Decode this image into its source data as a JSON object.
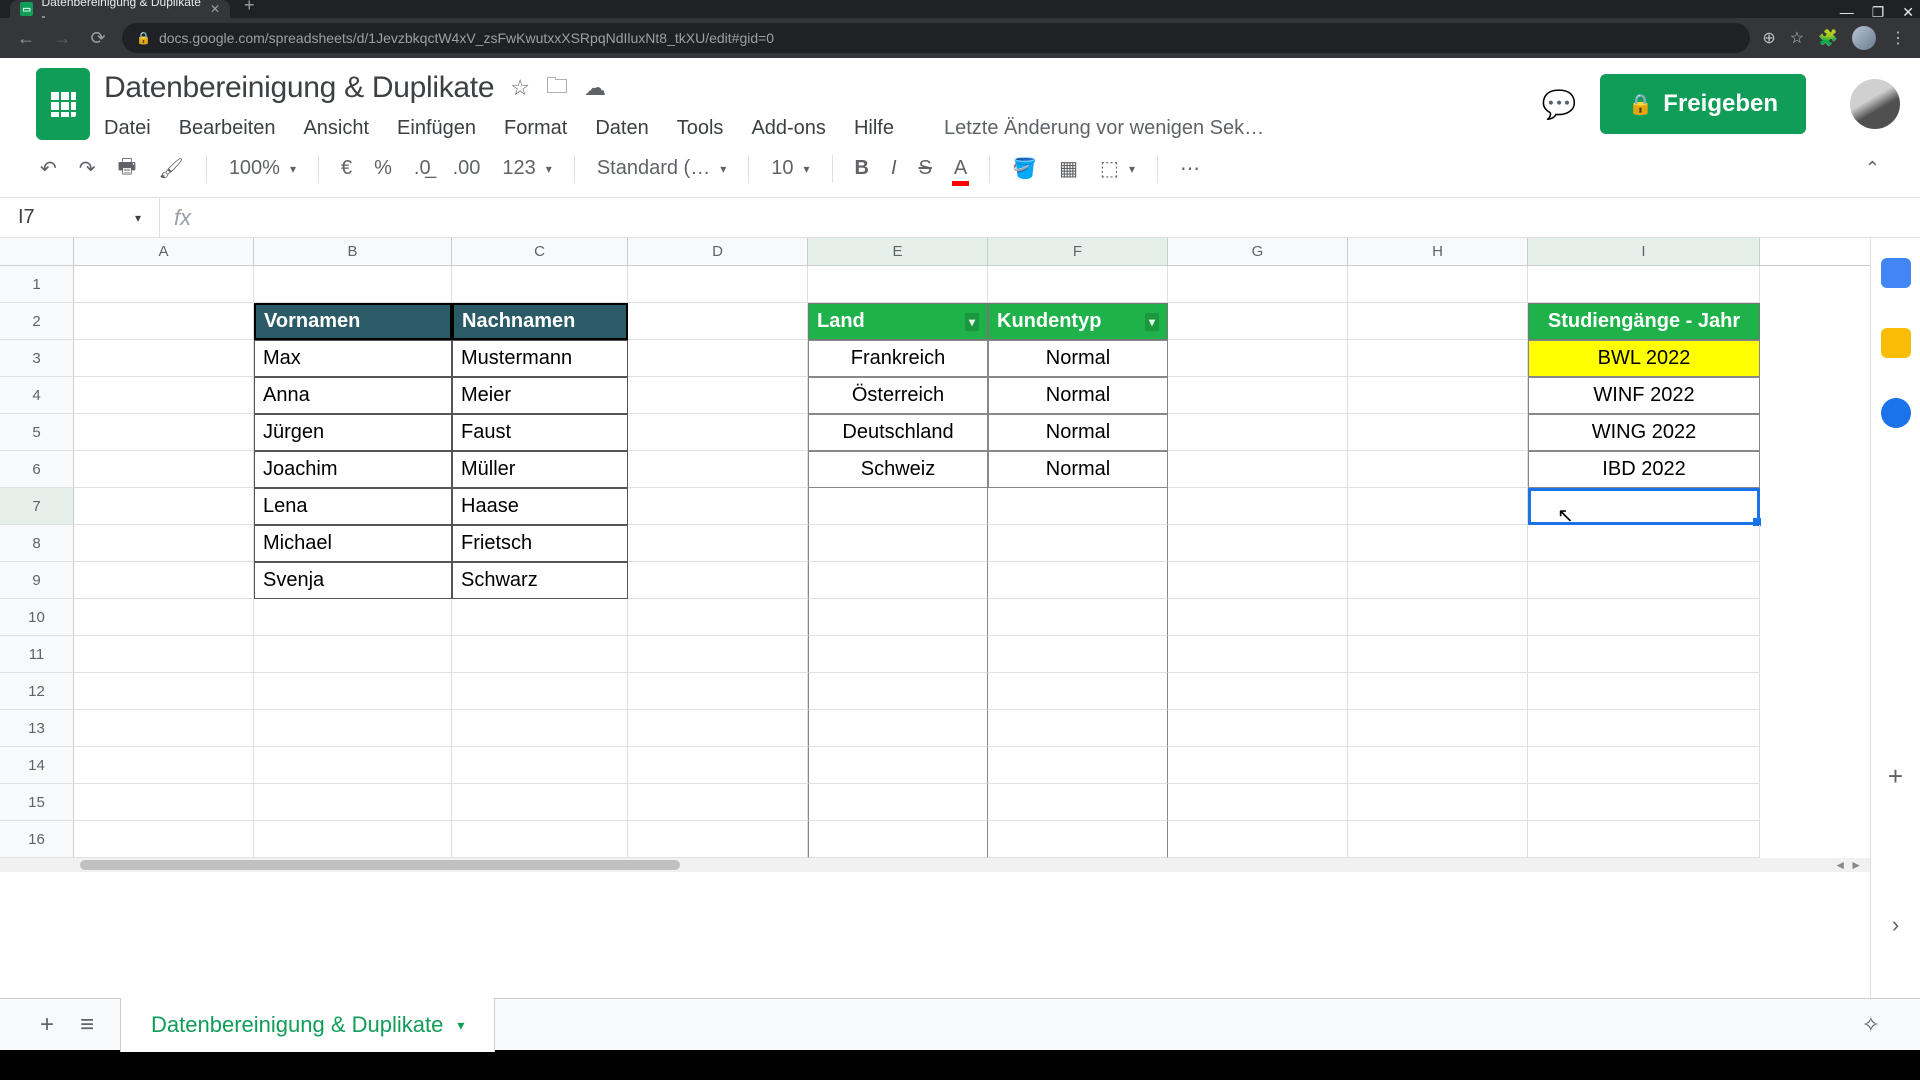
{
  "browser": {
    "tab_title": "Datenbereinigung & Duplikate -",
    "url": "docs.google.com/spreadsheets/d/1JevzbkqctW4xV_zsFwKwutxxXSRpqNdIluxNt8_tkXU/edit#gid=0"
  },
  "doc": {
    "title": "Datenbereinigung & Duplikate",
    "last_change": "Letzte Änderung vor wenigen Sek…"
  },
  "menus": {
    "file": "Datei",
    "edit": "Bearbeiten",
    "view": "Ansicht",
    "insert": "Einfügen",
    "format": "Format",
    "data": "Daten",
    "tools": "Tools",
    "addons": "Add-ons",
    "help": "Hilfe"
  },
  "share_label": "Freigeben",
  "toolbar": {
    "zoom": "100%",
    "font": "Standard (…",
    "font_size": "10",
    "number_format": "123",
    "currency": "€",
    "percent": "%"
  },
  "name_box": "I7",
  "fx_value": "",
  "cols": [
    "A",
    "B",
    "C",
    "D",
    "E",
    "F",
    "G",
    "H",
    "I"
  ],
  "rows": [
    "1",
    "2",
    "3",
    "4",
    "5",
    "6",
    "7",
    "8",
    "9",
    "10",
    "11",
    "12",
    "13",
    "14",
    "15",
    "16"
  ],
  "table1": {
    "headers": [
      "Vornamen",
      "Nachnamen"
    ],
    "rows": [
      [
        "Max",
        "Mustermann"
      ],
      [
        "Anna",
        "Meier"
      ],
      [
        "Jürgen",
        "Faust"
      ],
      [
        "Joachim",
        "Müller"
      ],
      [
        "Lena",
        "Haase"
      ],
      [
        "Michael",
        "Frietsch"
      ],
      [
        "Svenja",
        "Schwarz"
      ]
    ]
  },
  "table2": {
    "headers": [
      "Land",
      "Kundentyp"
    ],
    "rows": [
      [
        "Frankreich",
        "Normal"
      ],
      [
        "Österreich",
        "Normal"
      ],
      [
        "Deutschland",
        "Normal"
      ],
      [
        "Schweiz",
        "Normal"
      ]
    ]
  },
  "table3": {
    "header": "Studiengänge - Jahr",
    "rows": [
      "BWL 2022",
      "WINF 2022",
      "WING 2022",
      "IBD 2022"
    ]
  },
  "sheet_tab": "Datenbereinigung & Duplikate"
}
